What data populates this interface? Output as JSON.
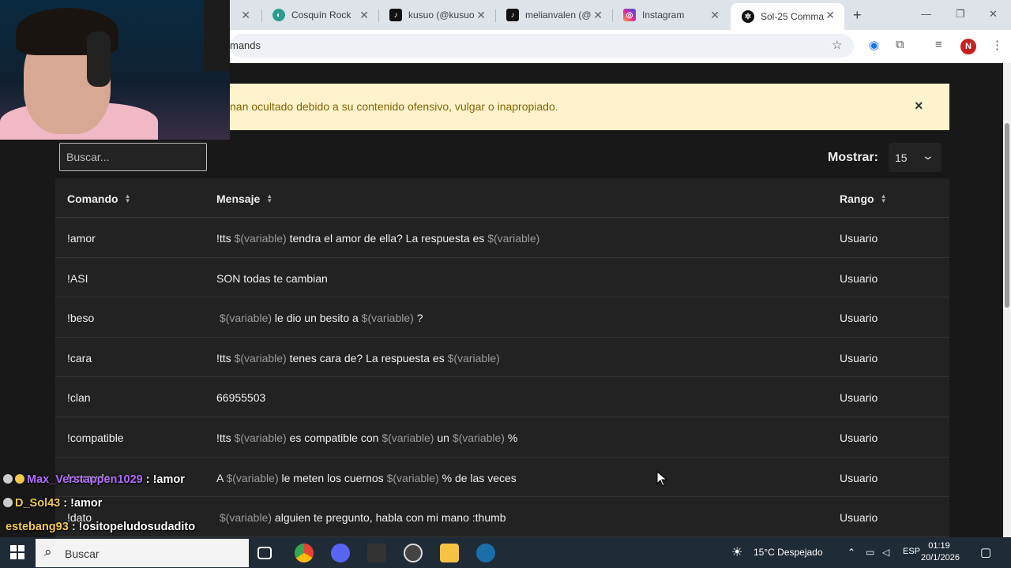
{
  "browser": {
    "tabs": [
      {
        "label": "",
        "icon": "tab-icon"
      },
      {
        "label": "Cosquín Rock",
        "icon": "cosquin-icon"
      },
      {
        "label": "kusuo (@kusuo",
        "icon": "tiktok-icon"
      },
      {
        "label": "melianvalen (@",
        "icon": "tiktok-icon"
      },
      {
        "label": "Instagram",
        "icon": "instagram-icon"
      },
      {
        "label": "Sol-25 Comman",
        "icon": "openai-icon"
      }
    ],
    "new_tab": "+",
    "address": "mands",
    "profile_initial": "N"
  },
  "alert": {
    "message": "nan ocultado debido a su contenido ofensivo, vulgar o inapropiado.",
    "close": "×"
  },
  "controls": {
    "search_placeholder": "Buscar...",
    "show_label": "Mostrar:",
    "show_value": "15"
  },
  "table": {
    "headers": [
      "Comando",
      "Mensaje",
      "Rango"
    ],
    "rows": [
      {
        "command": "!amor",
        "message": [
          [
            "",
            "!tts "
          ],
          [
            "v",
            "$(variable)"
          ],
          [
            "",
            " tendra el amor de ella? La respuesta es "
          ],
          [
            "v",
            "$(variable)"
          ]
        ],
        "rank": "Usuario"
      },
      {
        "command": "!ASI",
        "message": [
          [
            "",
            "SON todas te cambian"
          ]
        ],
        "rank": "Usuario"
      },
      {
        "command": "!beso",
        "message": [
          [
            "",
            " "
          ],
          [
            "v",
            "$(variable)"
          ],
          [
            "",
            " le dio un besito a "
          ],
          [
            "v",
            "$(variable)"
          ],
          [
            "",
            " ?"
          ]
        ],
        "rank": "Usuario"
      },
      {
        "command": "!cara",
        "message": [
          [
            "",
            "!tts "
          ],
          [
            "v",
            "$(variable)"
          ],
          [
            "",
            " tenes cara de? La respuesta es "
          ],
          [
            "v",
            "$(variable)"
          ]
        ],
        "rank": "Usuario"
      },
      {
        "command": "!clan",
        "message": [
          [
            "",
            "66955503"
          ]
        ],
        "rank": "Usuario"
      },
      {
        "command": "!compatible",
        "message": [
          [
            "",
            "!tts "
          ],
          [
            "v",
            "$(variable)"
          ],
          [
            "",
            " es compatible con "
          ],
          [
            "v",
            "$(variable)"
          ],
          [
            "",
            " un "
          ],
          [
            "v",
            "$(variable)"
          ],
          [
            "",
            " %"
          ]
        ],
        "rank": "Usuario"
      },
      {
        "command": "!cornudo",
        "message": [
          [
            "",
            "A "
          ],
          [
            "v",
            "$(variable)"
          ],
          [
            "",
            " le meten los cuernos "
          ],
          [
            "v",
            "$(variable)"
          ],
          [
            "",
            " % de las veces"
          ]
        ],
        "rank": "Usuario"
      },
      {
        "command": "!dato",
        "message": [
          [
            "",
            " "
          ],
          [
            "v",
            "$(variable)"
          ],
          [
            "",
            " alguien te pregunto, habla con mi mano :thumb"
          ]
        ],
        "rank": "Usuario"
      }
    ]
  },
  "chat": [
    {
      "user": "Max_Verstappen1029",
      "text": " : !amor"
    },
    {
      "user": "D_Sol43",
      "text": " : !amor"
    },
    {
      "user": "estebang93",
      "text": " : !ositopeludosudadito"
    }
  ],
  "taskbar": {
    "search": "Buscar",
    "weather": "15°C  Despejado",
    "lang": "ESP",
    "time": "01:19",
    "date": "20/1/2026"
  },
  "colors": {
    "accent": "#fff3cd",
    "variable": "#9a9a9a",
    "chat_user1": "#b36bff",
    "chat_user2": "#f2c94c"
  }
}
